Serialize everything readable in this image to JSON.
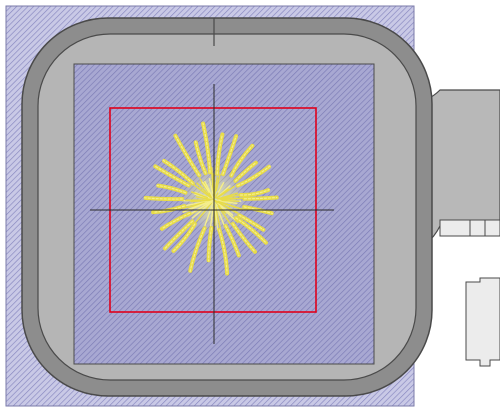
{
  "colors": {
    "background": "#ffffff",
    "sewable_area_fill": "#c9c9e6",
    "sewable_area_hatch": "#8686bf",
    "sewable_area_border": "#7a7aa8",
    "hoop_outer": "#8d8d8d",
    "hoop_outline": "#4a4a4a",
    "hoop_inner_ring": "#b5b5b5",
    "hoop_arm": "#b8b8b8",
    "hoop_clamp": "#ececec",
    "stitch_field_fill": "#a8a8d2",
    "stitch_field_hatch": "#7b7bb5",
    "design_bounds": "#e0001b",
    "crosshair": "#2a2a2a",
    "stitch_yellow": "#e8dc48",
    "stitch_yellow_light": "#f4ee8e",
    "stitch_center": "#dde8b8"
  },
  "icons": {
    "hoop": "embroidery-hoop-icon",
    "design": "sunburst-stitch-design-icon"
  }
}
